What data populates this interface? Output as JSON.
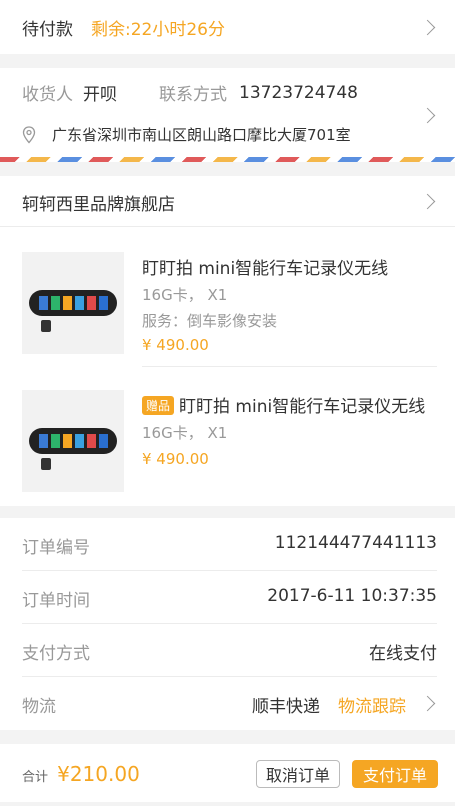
{
  "status": {
    "label": "待付款",
    "remaining": "剩余:22小时26分"
  },
  "address": {
    "receiver_label": "收货人",
    "receiver_name": "开呗",
    "contact_label": "联系方式",
    "phone": "13723724748",
    "address": "广东省深圳市南山区朗山路口摩比大厦701室"
  },
  "store": {
    "name": "轲轲西里品牌旗舰店"
  },
  "items": [
    {
      "title": "盯盯拍 mini智能行车记录仪无线",
      "spec": "16G卡， X1",
      "service": "服务：倒车影像安装",
      "price": "¥ 490.00"
    },
    {
      "gift_badge": "赠品",
      "title": "盯盯拍 mini智能行车记录仪无线",
      "spec": "16G卡， X1",
      "price": "¥ 490.00"
    }
  ],
  "info": {
    "order_no_label": "订单编号",
    "order_no": "112144477441113",
    "order_time_label": "订单时间",
    "order_time": "2017-6-11 10:37:35",
    "pay_method_label": "支付方式",
    "pay_method": "在线支付",
    "logistics_label": "物流",
    "logistics_company": "顺丰快递",
    "logistics_track": "物流跟踪"
  },
  "footer": {
    "total_label": "合计",
    "total": "¥210.00",
    "cancel": "取消订单",
    "pay": "支付订单"
  },
  "colors": {
    "accent": "#f5a623",
    "stripe_red": "#e05a5a",
    "stripe_yellow": "#f4b74a",
    "stripe_blue": "#5a8fe0"
  }
}
